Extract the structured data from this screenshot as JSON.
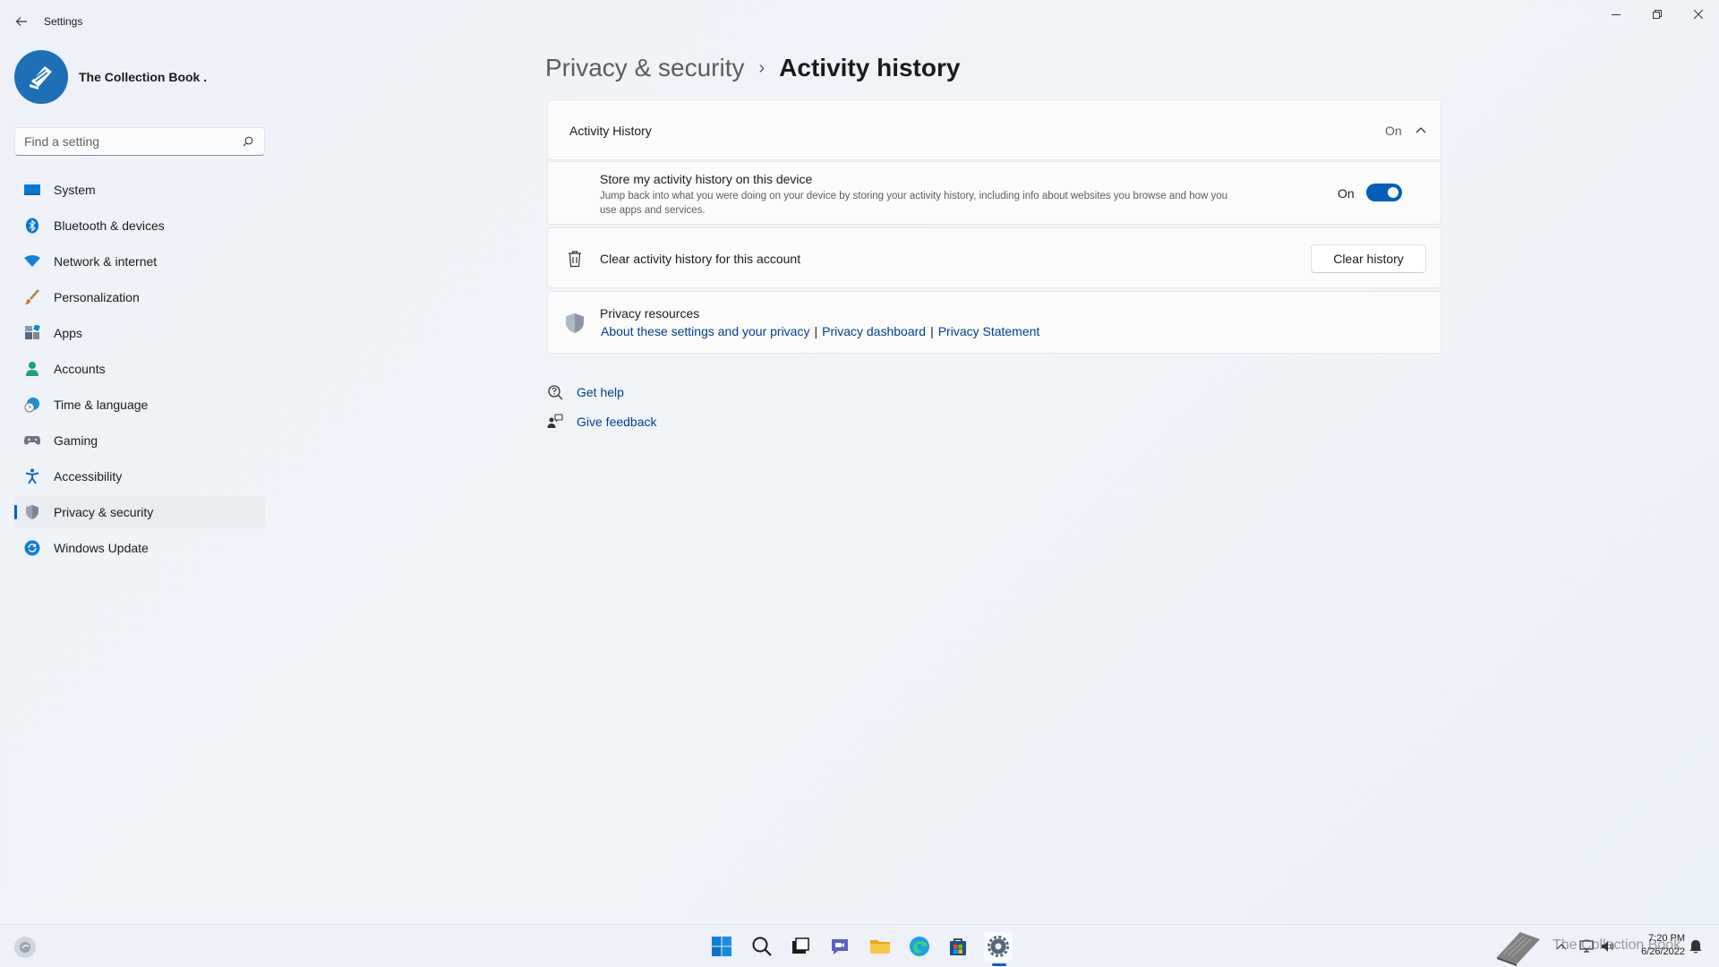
{
  "window": {
    "title": "Settings",
    "back_icon": "back-arrow-icon",
    "controls": [
      "minimize-icon",
      "maximize-icon",
      "close-icon"
    ]
  },
  "profile": {
    "name": "The Collection Book .",
    "avatar_icon": "book-logo-icon"
  },
  "search": {
    "placeholder": "Find a setting",
    "value": ""
  },
  "sidebar": {
    "items": [
      {
        "label": "System",
        "icon": "system-display-icon",
        "color": "#0078d4"
      },
      {
        "label": "Bluetooth & devices",
        "icon": "bluetooth-icon",
        "color": "#0078d4"
      },
      {
        "label": "Network & internet",
        "icon": "wifi-icon",
        "color": "#0a84d8"
      },
      {
        "label": "Personalization",
        "icon": "brush-icon",
        "color": "#d96a2b"
      },
      {
        "label": "Apps",
        "icon": "apps-icon",
        "color": "#55657a"
      },
      {
        "label": "Accounts",
        "icon": "person-icon",
        "color": "#1aa37a"
      },
      {
        "label": "Time & language",
        "icon": "globe-clock-icon",
        "color": "#1d8fd6"
      },
      {
        "label": "Gaming",
        "icon": "gamepad-icon",
        "color": "#6b7584"
      },
      {
        "label": "Accessibility",
        "icon": "accessibility-icon",
        "color": "#1466b8"
      },
      {
        "label": "Privacy & security",
        "icon": "shield-icon",
        "color": "#7a8494",
        "active": true
      },
      {
        "label": "Windows Update",
        "icon": "update-icon",
        "color": "#0f7fd1"
      }
    ]
  },
  "breadcrumb": {
    "parent": "Privacy & security",
    "separator": "›",
    "current": "Activity history"
  },
  "activity": {
    "header_label": "Activity History",
    "header_state": "On",
    "store_title": "Store my activity history on this device",
    "store_desc": "Jump back into what you were doing on your device by storing your activity history, including info about websites you browse and how you use apps and services.",
    "toggle_label": "On",
    "toggle_on": true,
    "clear_label": "Clear activity history for this account",
    "clear_button": "Clear history"
  },
  "privacy": {
    "title": "Privacy resources",
    "links": [
      "About these settings and your privacy",
      "Privacy dashboard",
      "Privacy Statement"
    ]
  },
  "help": {
    "get_help": "Get help",
    "give_feedback": "Give feedback"
  },
  "taskbar": {
    "apps": [
      "start-icon",
      "search-icon",
      "task-view-icon",
      "chat-icon",
      "file-explorer-icon",
      "edge-icon",
      "store-icon",
      "settings-icon"
    ],
    "active_app": "settings-icon",
    "tray_icons": [
      "chevron-up-icon",
      "network-icon",
      "volume-icon"
    ],
    "time": "7:20 PM",
    "date": "6/26/2022",
    "watermark": "The Collection Book"
  },
  "colors": {
    "accent": "#005fb8",
    "link": "#003e92"
  }
}
